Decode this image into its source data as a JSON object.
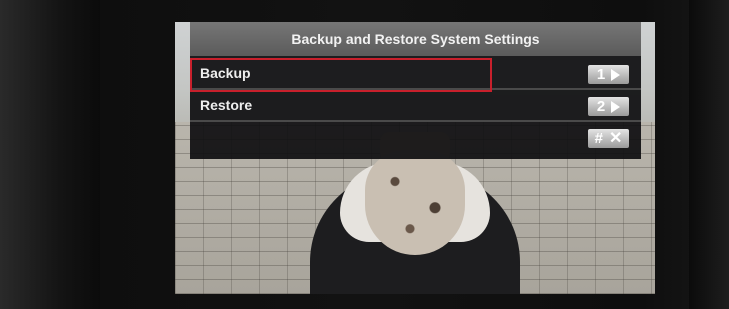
{
  "menu": {
    "title": "Backup and Restore System Settings",
    "items": [
      {
        "label": "Backup",
        "key": "1",
        "selected": true
      },
      {
        "label": "Restore",
        "key": "2",
        "selected": false
      }
    ],
    "close_key": "#"
  },
  "colors": {
    "selection_border": "#c8202c",
    "title_bar": "#6a6a6a",
    "menu_bg": "#0e0e10"
  },
  "icons": {
    "forward": "right-arrow-icon",
    "close": "close-icon"
  }
}
